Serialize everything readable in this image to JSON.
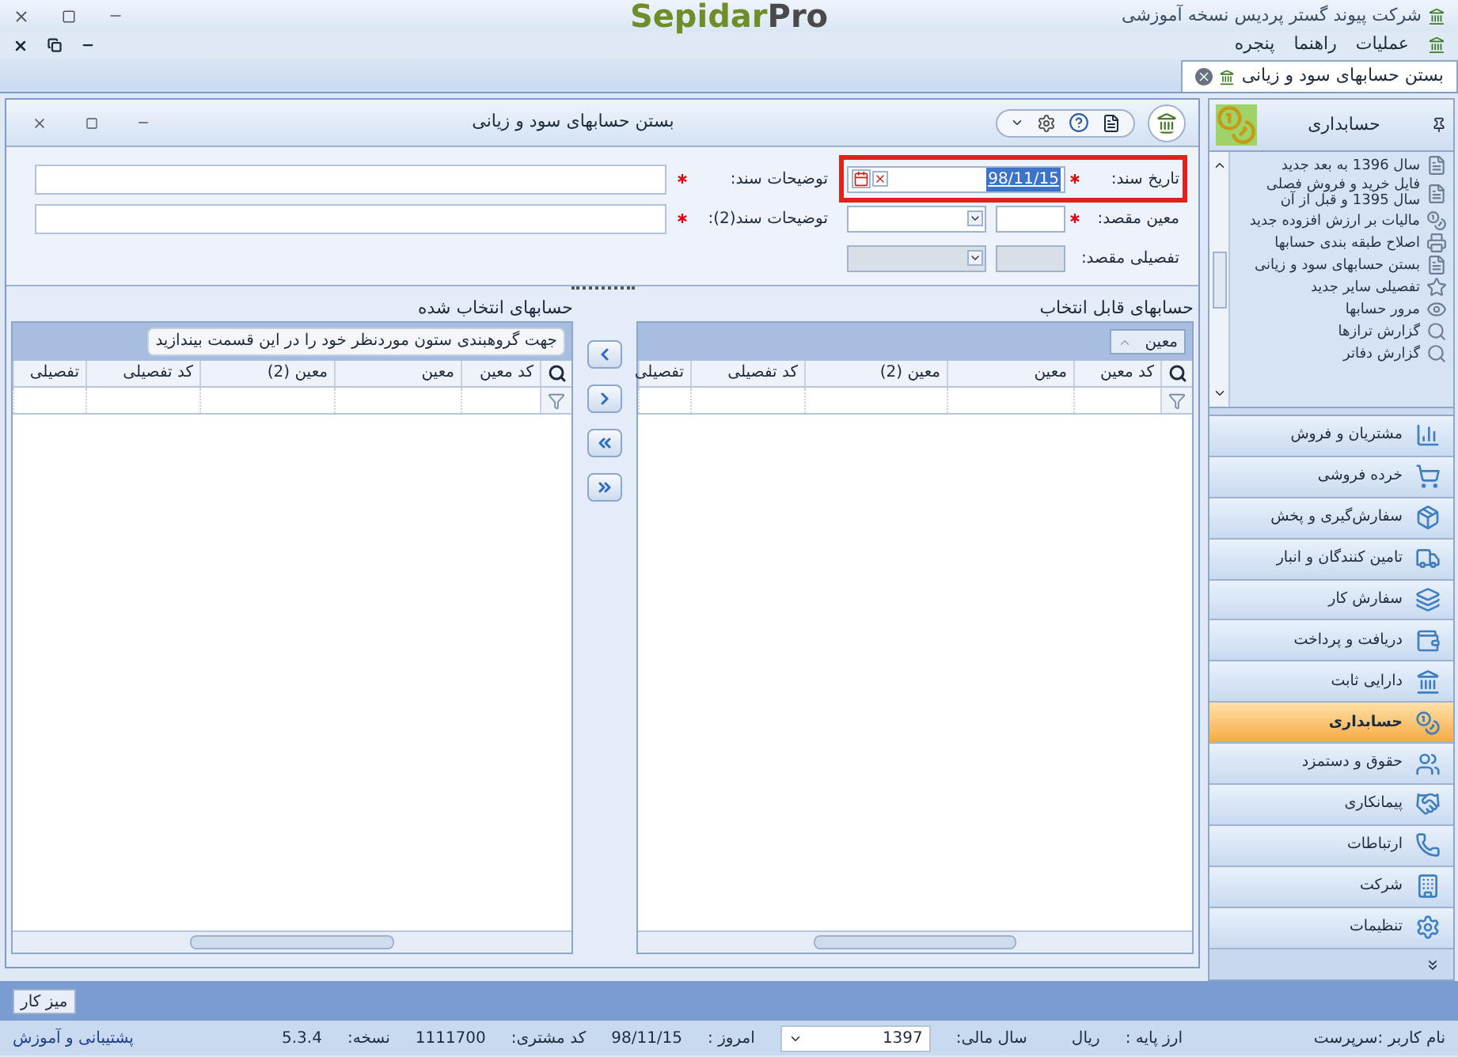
{
  "app_title": "شرکت پیوند گستر پردیس نسخه آموزشی",
  "logo": {
    "part_1": "Sepidar",
    "part_2": "Pro"
  },
  "menu": [
    "عملیات",
    "راهنما",
    "پنجره"
  ],
  "doc_tabs": [
    {
      "label": "بستن حسابهای سود و زیانی",
      "selected": true
    }
  ],
  "form_window": {
    "title": "بستن حسابهای سود و زیانی"
  },
  "fields": [
    {
      "kind": "date",
      "label": "تاریخ سند:",
      "required": true,
      "value": "98/11/15",
      "highlighted": true
    },
    {
      "kind": "combo",
      "label": "معین مقصد:",
      "required": true,
      "disabled": false,
      "highlighted": false
    },
    {
      "kind": "combo",
      "label": "تفصیلی مقصد:",
      "required": false,
      "disabled": true,
      "highlighted": false
    }
  ],
  "descriptions": [
    {
      "label": "توضیحات سند:",
      "required": true
    },
    {
      "label": "توضیحات سند(2):",
      "required": true
    }
  ],
  "available_grid": {
    "title": "حسابهای قابل انتخاب",
    "group_chip": "معین",
    "columns": [
      "کد معین",
      "معین",
      "معین (2)",
      "کد تفصیلی",
      "تفصیلی"
    ]
  },
  "selected_grid": {
    "title": "حسابهای انتخاب شده",
    "group_hint": "جهت گروهبندی ستون موردنظر خود را در این قسمت بیندازید",
    "columns": [
      "کد معین",
      "معین",
      "معین (2)",
      "کد تفصیلی",
      "تفصیلی"
    ]
  },
  "sidebar": {
    "header": "حسابداری",
    "items": [
      {
        "label": "سال 1396 به بعد جدید",
        "selected": false
      },
      {
        "label": "فایل خرید و فروش فصلی سال 1395 و قبل از آن",
        "selected": false
      },
      {
        "label": "مالیات بر ارزش افزوده جدید",
        "selected": false
      },
      {
        "label": "اصلاح طبقه بندی حسابها",
        "selected": false
      },
      {
        "label": "بستن حسابهای سود و زیانی",
        "selected": false
      },
      {
        "label": "تفصیلی سایر جدید",
        "selected": false
      },
      {
        "label": "مرور حسابها",
        "selected": false
      },
      {
        "label": "گزارش ترازها",
        "selected": false
      },
      {
        "label": "گزارش دفاتر",
        "selected": false
      }
    ]
  },
  "modules": [
    {
      "label": "مشتریان و فروش",
      "selected": false
    },
    {
      "label": "خرده فروشی",
      "selected": false
    },
    {
      "label": "سفارش‌گیری و پخش",
      "selected": false
    },
    {
      "label": "تامین کنندگان و انبار",
      "selected": false
    },
    {
      "label": "سفارش کار",
      "selected": false
    },
    {
      "label": "دریافت و پرداخت",
      "selected": false
    },
    {
      "label": "دارایی ثابت",
      "selected": false
    },
    {
      "label": "حسابداری",
      "selected": true
    },
    {
      "label": "حقوق و دستمزد",
      "selected": false
    },
    {
      "label": "پیمانکاری",
      "selected": false
    },
    {
      "label": "ارتباطات",
      "selected": false
    },
    {
      "label": "شرکت",
      "selected": false
    },
    {
      "label": "تنظیمات",
      "selected": false
    }
  ],
  "taskbar": {
    "button": "میز کار"
  },
  "status_bar": {
    "user": "نام کاربر :سرپرست",
    "currency_label": "ارز پایه :",
    "currency": "ریال",
    "fiscal_year_label": "سال مالی:",
    "fiscal_year": "1397",
    "today_label": "امروز :",
    "today": "98/11/15",
    "customer_code_label": "کد مشتری:",
    "customer_code": "1111700",
    "version_label": "نسخه:",
    "version": "5.3.4",
    "support_link": "پشتیبانی و آموزش"
  }
}
